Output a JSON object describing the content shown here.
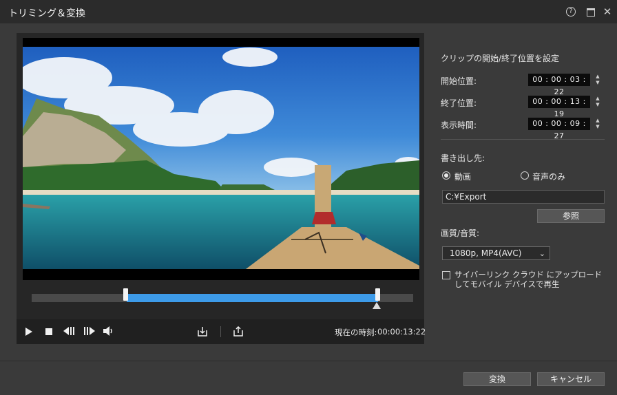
{
  "window": {
    "title": "トリミング＆変換"
  },
  "player": {
    "current_time_label": "現在の時刻:",
    "current_time_value": "00:00:13:22"
  },
  "clip": {
    "heading": "クリップの開始/終了位置を設定",
    "start_label": "開始位置:",
    "start_value": "00 : 00 : 03 : 22",
    "end_label": "終了位置:",
    "end_value": "00 : 00 : 13 : 19",
    "duration_label": "表示時間:",
    "duration_value": "00 : 00 : 09 : 27"
  },
  "export": {
    "heading": "書き出し先:",
    "option_video": "動画",
    "option_audio": "音声のみ",
    "path": "C:¥Export",
    "browse_label": "参照"
  },
  "quality": {
    "label": "画質/音質:",
    "selected": "1080p, MP4(AVC)"
  },
  "upload": {
    "label": "サイバーリンク クラウド にアップロードしてモバイル デバイスで再生",
    "checked": false
  },
  "footer": {
    "convert_label": "変換",
    "cancel_label": "キャンセル"
  },
  "colors": {
    "accent": "#3d9be9",
    "background": "#3a3a3a"
  },
  "icons": [
    "help-icon",
    "maximize-icon",
    "close-icon",
    "play-icon",
    "stop-icon",
    "prev-frame-icon",
    "next-frame-icon",
    "volume-icon",
    "mark-in-icon",
    "mark-out-icon",
    "dropdown-arrow-icon"
  ]
}
